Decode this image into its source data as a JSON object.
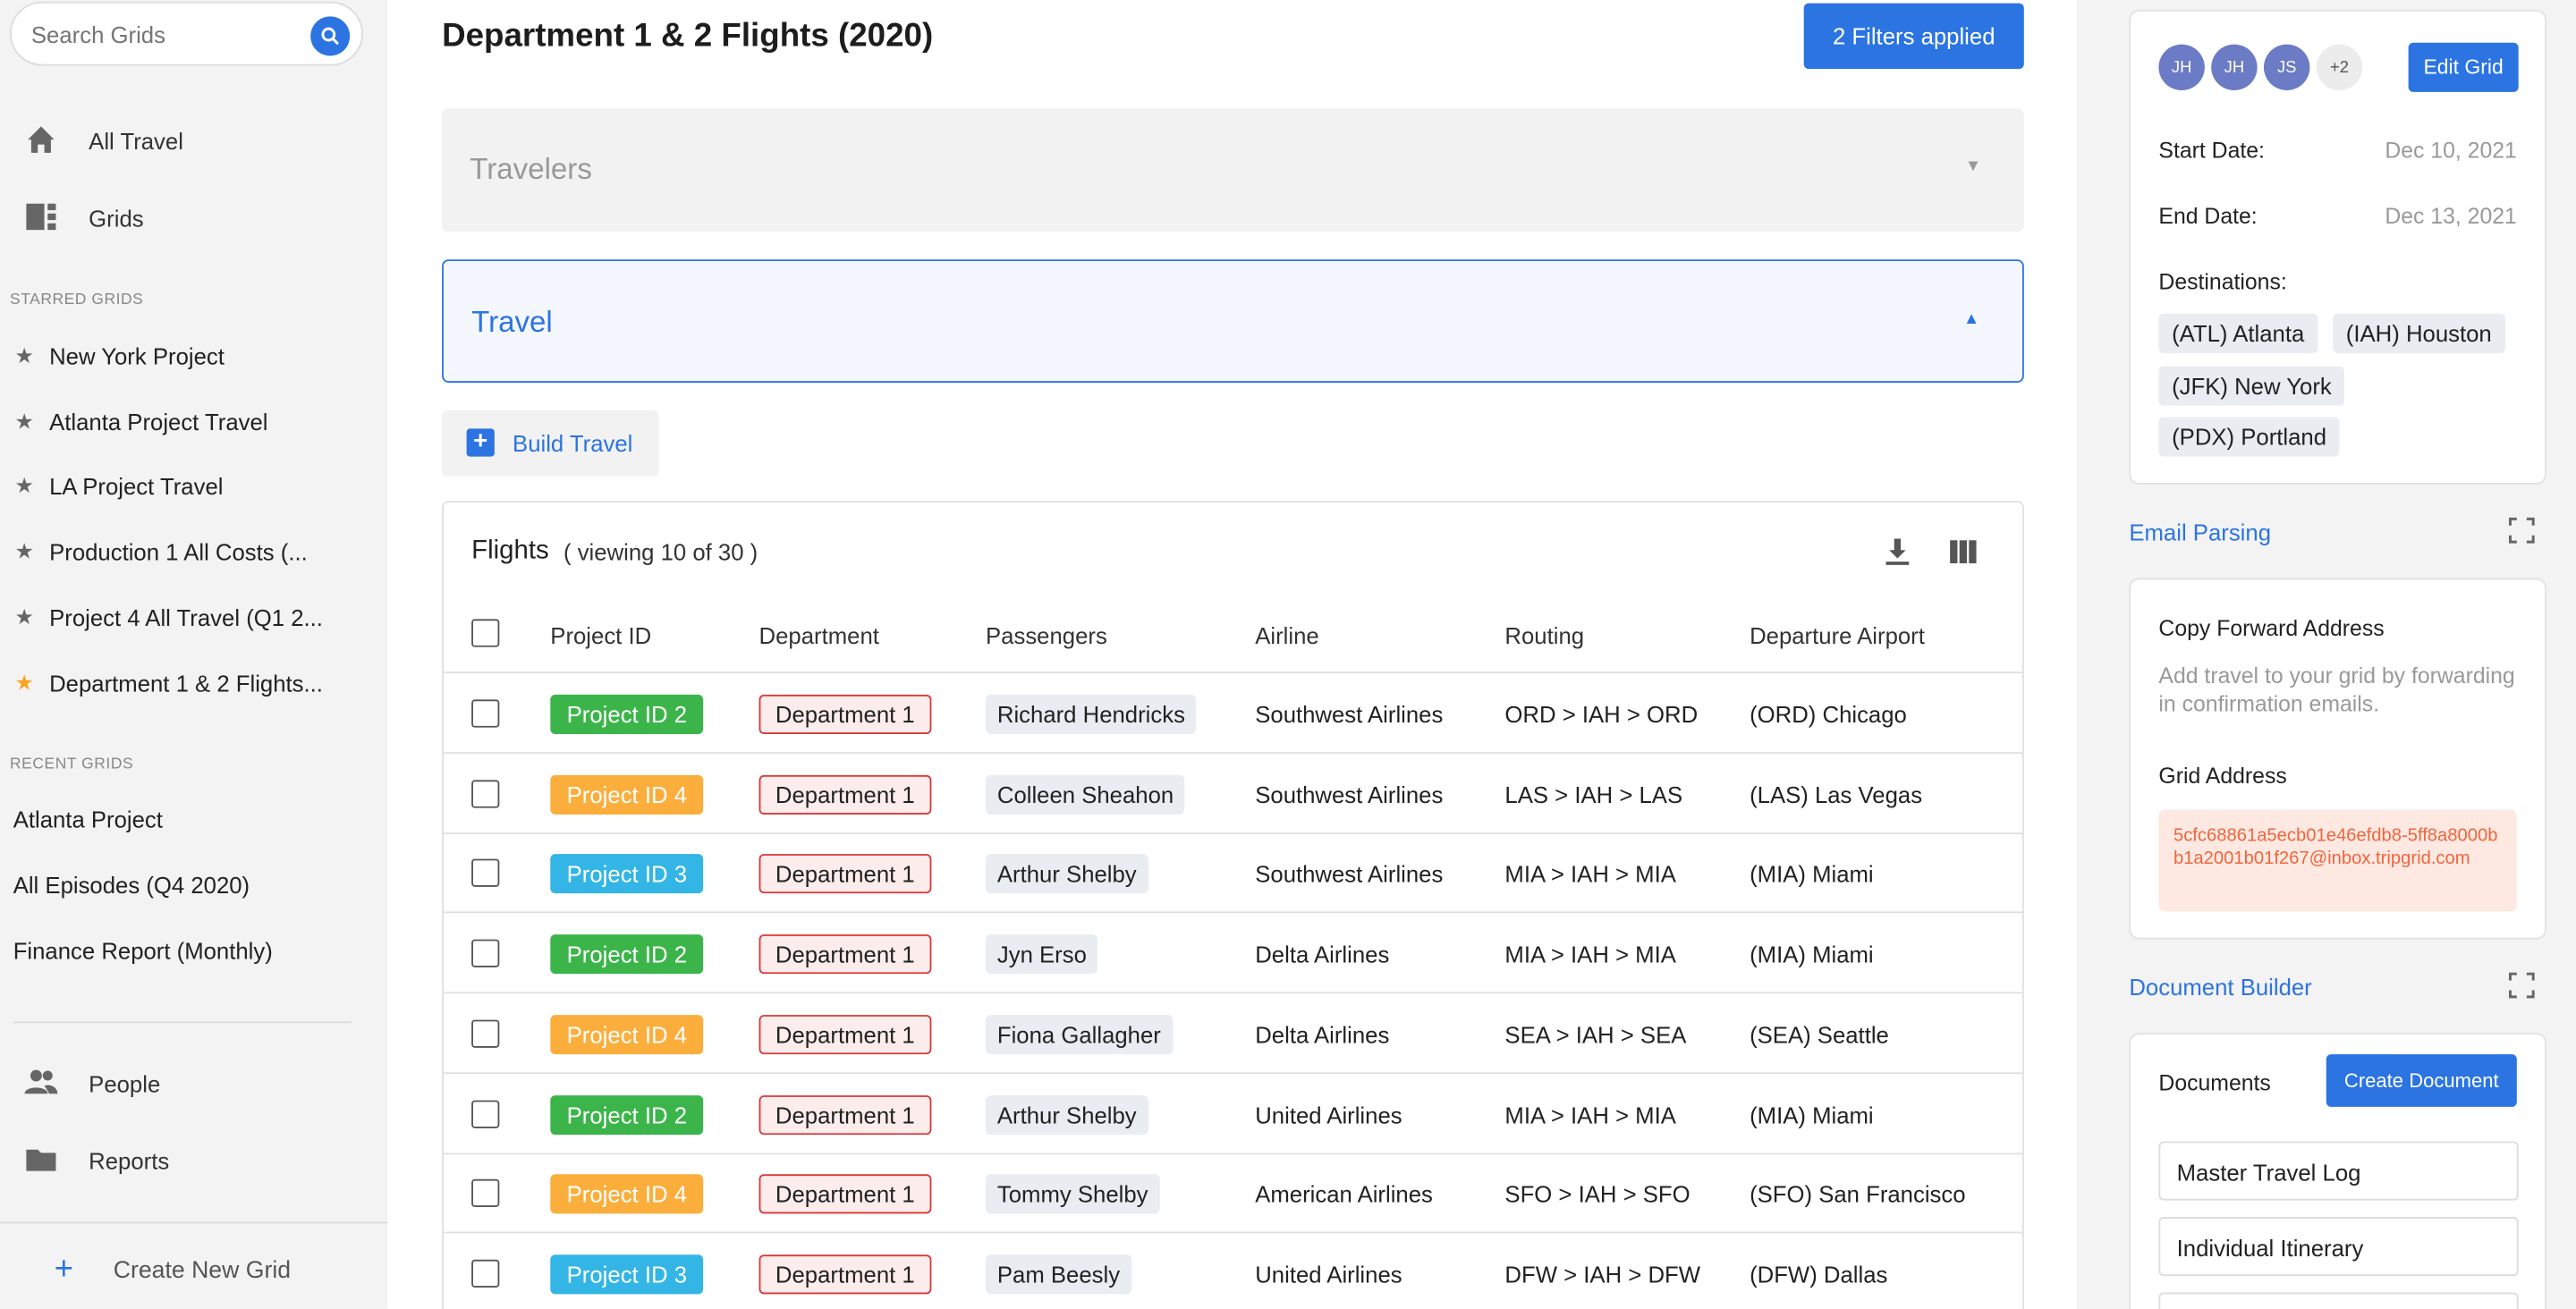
{
  "sidebar": {
    "search_placeholder": "Search Grids",
    "nav": [
      {
        "label": "All Travel",
        "icon": "home-icon"
      },
      {
        "label": "Grids",
        "icon": "grid-icon"
      }
    ],
    "starred_title": "STARRED GRIDS",
    "starred": [
      {
        "label": "New York Project",
        "active": false
      },
      {
        "label": "Atlanta Project Travel",
        "active": false
      },
      {
        "label": "LA Project Travel",
        "active": false
      },
      {
        "label": "Production 1 All Costs (...",
        "active": false
      },
      {
        "label": "Project 4 All Travel (Q1 2...",
        "active": false
      },
      {
        "label": "Department 1 & 2 Flights...",
        "active": true
      }
    ],
    "recent_title": "RECENT GRIDS",
    "recent": [
      "Atlanta Project",
      "All Episodes (Q4 2020)",
      "Finance Report (Monthly)"
    ],
    "bottom_nav": [
      {
        "label": "People",
        "icon": "people-icon"
      },
      {
        "label": "Reports",
        "icon": "folder-icon"
      }
    ],
    "create_label": "Create New Grid"
  },
  "main": {
    "title": "Department 1 & 2 Flights (2020)",
    "filters_label": "2 Filters applied",
    "travelers_label": "Travelers",
    "travel_label": "Travel",
    "build_label": "Build Travel",
    "flights": {
      "title": "Flights",
      "count": "( viewing 10 of 30 )",
      "columns": [
        "Project ID",
        "Department",
        "Passengers",
        "Airline",
        "Routing",
        "Departure Airport"
      ],
      "rows": [
        {
          "project": "Project ID 2",
          "dept": "Department 1",
          "passenger": "Richard Hendricks",
          "airline": "Southwest Airlines",
          "routing": "ORD > IAH > ORD",
          "airport": "(ORD) Chicago"
        },
        {
          "project": "Project ID 4",
          "dept": "Department 1",
          "passenger": "Colleen Sheahon",
          "airline": "Southwest Airlines",
          "routing": "LAS > IAH > LAS",
          "airport": "(LAS) Las Vegas"
        },
        {
          "project": "Project ID 3",
          "dept": "Department 1",
          "passenger": "Arthur Shelby",
          "airline": "Southwest Airlines",
          "routing": "MIA > IAH > MIA",
          "airport": "(MIA) Miami"
        },
        {
          "project": "Project ID 2",
          "dept": "Department 1",
          "passenger": "Jyn Erso",
          "airline": "Delta Airlines",
          "routing": "MIA > IAH > MIA",
          "airport": "(MIA) Miami"
        },
        {
          "project": "Project ID 4",
          "dept": "Department 1",
          "passenger": "Fiona Gallagher",
          "airline": "Delta Airlines",
          "routing": "SEA > IAH > SEA",
          "airport": "(SEA) Seattle"
        },
        {
          "project": "Project ID 2",
          "dept": "Department 1",
          "passenger": "Arthur Shelby",
          "airline": "United Airlines",
          "routing": "MIA > IAH > MIA",
          "airport": "(MIA) Miami"
        },
        {
          "project": "Project ID 4",
          "dept": "Department 1",
          "passenger": "Tommy Shelby",
          "airline": "American Airlines",
          "routing": "SFO > IAH > SFO",
          "airport": "(SFO) San Francisco"
        },
        {
          "project": "Project ID 3",
          "dept": "Department 1",
          "passenger": "Pam Beesly",
          "airline": "United Airlines",
          "routing": "DFW > IAH > DFW",
          "airport": "(DFW) Dallas"
        }
      ]
    }
  },
  "colors": {
    "accent": "#2b74e2",
    "project_id_2": "#3bb54a",
    "project_id_3": "#33b5e5",
    "project_id_4": "#fbae3c",
    "department_border": "#d9383a"
  },
  "right": {
    "avatars": [
      "JH",
      "JH",
      "JS",
      "+2"
    ],
    "edit_label": "Edit Grid",
    "start_label": "Start Date:",
    "start_value": "Dec 10, 2021",
    "end_label": "End Date:",
    "end_value": "Dec 13, 2021",
    "dest_label": "Destinations:",
    "destinations": [
      "(ATL) Atlanta",
      "(IAH) Houston",
      "(JFK) New York",
      "(PDX) Portland"
    ],
    "email_title": "Email Parsing",
    "copy_title": "Copy Forward Address",
    "copy_sub": "Add travel to your grid by forwarding in confirmation emails.",
    "grid_addr_title": "Grid Address",
    "grid_addr": "5cfc68861a5ecb01e46efdb8-5ff8a8000bb1a2001b01f267@inbox.tripgrid.com",
    "doc_builder_title": "Document Builder",
    "documents_title": "Documents",
    "create_doc_label": "Create Document",
    "documents": [
      "Master Travel Log",
      "Individual Itinerary"
    ]
  }
}
